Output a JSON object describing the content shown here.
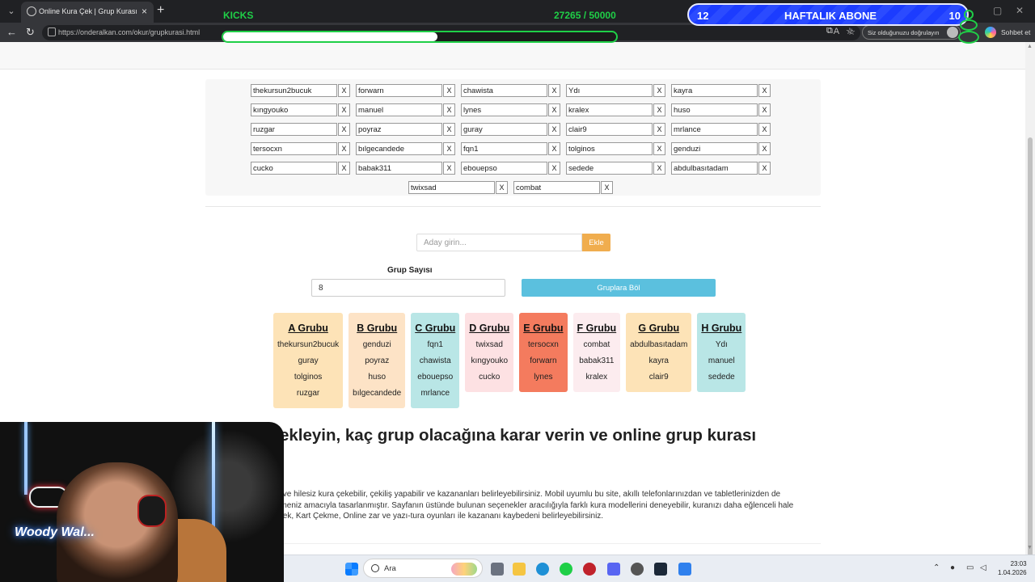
{
  "browser": {
    "tab_title": "Online Kura Çek | Grup Kurası",
    "url_host": "https://onderalkan.com",
    "url_path": "/okur/grupkurasi.html",
    "verify_text": "Siz olduğunuzu doğrulayın",
    "chat_label": "Sohbet et"
  },
  "overlay": {
    "kicks_label": "KICKS",
    "kicks_count": "27265 / 50000",
    "kicks_progress": 0.545,
    "sub_left": "12",
    "sub_title": "HAFTALIK ABONE",
    "sub_right": "10",
    "cam_logo": "Woody Wal..."
  },
  "names": [
    "thekursun2bucuk",
    "forwarn",
    "chawista",
    "Ydı",
    "kayra",
    "kıngyouko",
    "manuel",
    "lynes",
    "kralex",
    "huso",
    "ruzgar",
    "poyraz",
    "guray",
    "clair9",
    "mrlance",
    "tersocxn",
    "bılgecandede",
    "fqn1",
    "tolginos",
    "genduzi",
    "cucko",
    "babak311",
    "ebouepso",
    "sedede",
    "abdulbasıtadam",
    "twixsad",
    "combat"
  ],
  "remove_label": "X",
  "form": {
    "candidate_placeholder": "Aday girin...",
    "add_label": "Ekle",
    "count_label": "Grup Sayısı",
    "count_value": "8",
    "split_label": "Gruplara Böl"
  },
  "groups": [
    {
      "title": "A Grubu",
      "color": "#fde3b7",
      "members": [
        "thekursun2bucuk",
        "guray",
        "tolginos",
        "ruzgar"
      ]
    },
    {
      "title": "B Grubu",
      "color": "#fde3c6",
      "members": [
        "genduzi",
        "poyraz",
        "huso",
        "bılgecandede"
      ]
    },
    {
      "title": "C Grubu",
      "color": "#b9e6e6",
      "members": [
        "fqn1",
        "chawista",
        "ebouepso",
        "mrlance"
      ]
    },
    {
      "title": "D Grubu",
      "color": "#fde1e3",
      "members": [
        "twixsad",
        "kıngyouko",
        "cucko"
      ]
    },
    {
      "title": "E Grubu",
      "color": "#f47b5e",
      "members": [
        "tersocxn",
        "forwarn",
        "lynes"
      ]
    },
    {
      "title": "F Grubu",
      "color": "#fcecef",
      "members": [
        "combat",
        "babak311",
        "kralex"
      ]
    },
    {
      "title": "G Grubu",
      "color": "#fde3b7",
      "members": [
        "abdulbasıtadam",
        "kayra",
        "clair9"
      ]
    },
    {
      "title": "H Grubu",
      "color": "#b9e6e6",
      "members": [
        "Ydı",
        "manuel",
        "sedede"
      ]
    }
  ],
  "article": {
    "headline": "ekleyin, kaç grup olacağına karar verin ve online grup kurası",
    "lines": [
      "z ve hilesiz kura çekebilir, çekiliş yapabilir ve kazananları belirleyebilirsiniz. Mobil uyumlu bu site, akıllı telefonlarınızdan ve tabletlerinizden de",
      "ilmeniz amacıyla tasarlanmıştır. Sayfanın üstünde bulunan seçenekler aracılığıyla farklı kura modellerini deneyebilir, kuranızı daha eğlenceli hale",
      "elek, Kart Çekme, Online zar ve yazı-tura oyunları ile kazananı kaybedeni belirleyebilirsiniz."
    ]
  },
  "taskbar": {
    "search_text": "Ara",
    "time": "23:03",
    "date": "1.04.2026"
  }
}
